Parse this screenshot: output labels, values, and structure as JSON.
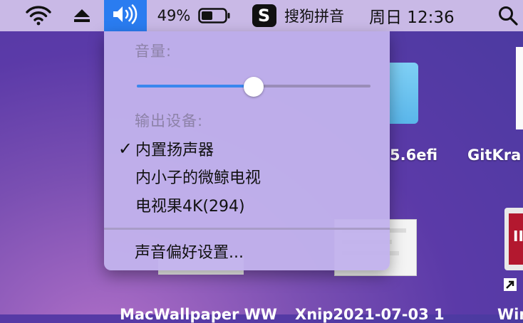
{
  "menubar": {
    "wifi_icon": "wifi-icon",
    "eject_icon": "eject-icon",
    "volume_icon": "speaker-icon",
    "battery_percent": "49%",
    "battery_level": 0.49,
    "ime_badge": "S",
    "ime_name": "搜狗拼音",
    "clock": "周日 12:36",
    "search_icon": "search-icon",
    "accent_color": "#2a7cf0"
  },
  "volume_menu": {
    "volume_header": "音量:",
    "volume_level": 0.5,
    "output_header": "输出设备:",
    "devices": [
      {
        "label": "内置扬声器",
        "checked": true
      },
      {
        "label": "内小子的微鲸电视",
        "checked": false
      },
      {
        "label": "电视果4K(294)",
        "checked": false
      }
    ],
    "check_mark": "✓",
    "prefs_label": "声音偏好设置..."
  },
  "desktop": {
    "item_labels": [
      "5.6efi",
      "GitKra"
    ],
    "bottom_labels": [
      "MacWallpaper WW",
      "Xnip2021-07-03 1",
      "Win"
    ],
    "app_icon_text": "II"
  }
}
